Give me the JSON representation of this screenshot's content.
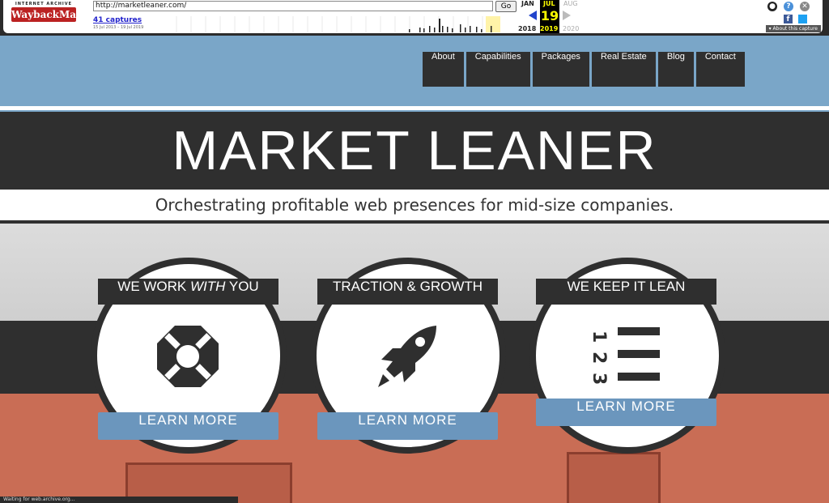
{
  "wayback": {
    "logo_top": "INTERNET ARCHIVE",
    "logo_main": "WaybackMachine",
    "url": "http://marketleaner.com/",
    "go_label": "Go",
    "captures": "41 captures",
    "date_range": "15 Jul 2013 – 19 Jul 2019",
    "months": [
      "JAN",
      "JUL",
      "AUG"
    ],
    "day": "19",
    "years": [
      "2018",
      "2019",
      "2020"
    ],
    "about": "About this capture"
  },
  "nav": {
    "items": [
      "About",
      "Capabilities",
      "Packages",
      "Real Estate",
      "Blog",
      "Contact"
    ]
  },
  "site": {
    "title": "MARKET LEANER",
    "tagline": "Orchestrating profitable web presences for mid-size companies."
  },
  "features": [
    {
      "label_a": "WE WORK ",
      "label_em": "WITH",
      "label_b": " YOU",
      "button": "LEARN MORE",
      "icon": "lifebuoy-icon"
    },
    {
      "label": "TRACTION & GROWTH",
      "button": "LEARN MORE",
      "icon": "rocket-icon"
    },
    {
      "label": "WE KEEP IT LEAN",
      "button": "LEARN MORE",
      "icon": "numbered-list-icon"
    }
  ],
  "list_numbers": [
    "1",
    "2",
    "3"
  ],
  "status": "Waiting for web.archive.org...",
  "colors": {
    "dark": "#2f2f2f",
    "button_blue": "#6b96bd",
    "sky": "#7aa6c8",
    "brick": "#c96d55"
  }
}
